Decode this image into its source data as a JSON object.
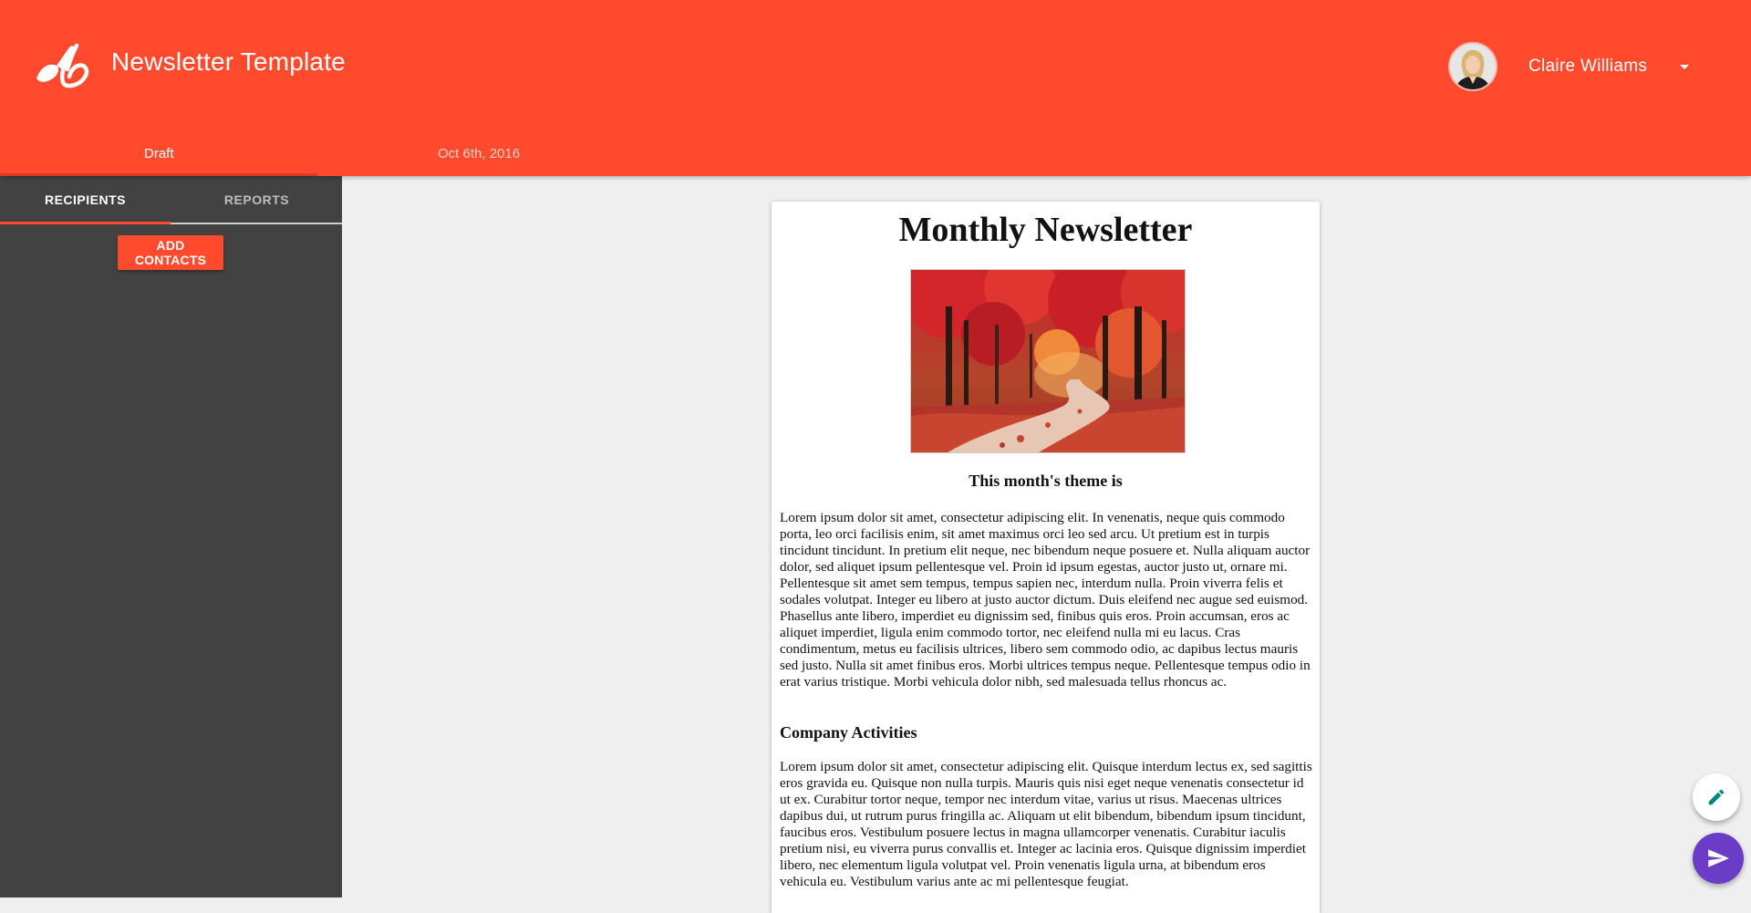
{
  "app": {
    "title": "Newsletter Template",
    "brand_color": "#ff4a2d"
  },
  "user": {
    "name": "Claire Williams",
    "menu_icon": "caret-down-icon"
  },
  "status_bar": {
    "status_label": "Draft",
    "date": "Oct 6th, 2016"
  },
  "sidebar": {
    "tabs": [
      {
        "label": "RECIPIENTS",
        "active": true
      },
      {
        "label": "REPORTS",
        "active": false
      }
    ],
    "add_contacts_label": "ADD CONTACTS",
    "background": "#424242"
  },
  "newsletter": {
    "title": "Monthly Newsletter",
    "image": "autumn-forest-path",
    "subtitle": "This month's theme is",
    "paragraph_1": "Lorem ipsum dolor sit amet, consectetur adipiscing elit. In venenatis, neque quis commodo porta, leo orci facilisis enim, sit amet maximus orci leo sed arcu. Ut pretium est in turpis tincidunt tincidunt. In pretium elit neque, nec bibendum neque posuere et. Nulla aliquam auctor dolor, sed aliquet ipsum pellentesque vel. Proin id ipsum egestas, auctor justo ut, ornare mi. Pellentesque sit amet sem tempus, tempus sapien nec, interdum nulla. Proin viverra felis et sodales volutpat. Integer eu libero at justo auctor dictum. Duis eleifend nec augue sed euismod. Phasellus ante libero, imperdiet eu dignissim sed, finibus quis eros. Proin accumsan, eros ac aliquet imperdiet, ligula enim commodo tortor, nec eleifend nulla mi eu lacus. Cras condimentum, metus eu facilisis ultrices, libero sem commodo odio, ac dapibus lectus mauris sed justo. Nulla sit amet finibus eros. Morbi ultrices tempus neque. Pellentesque tempus odio in erat varius tristique. Morbi vehicula dolor nibh, sed malesuada tellus rhoncus ac.",
    "heading_2": "Company Activities",
    "paragraph_2": "Lorem ipsum dolor sit amet, consectetur adipiscing elit. Quisque interdum lectus ex, sed sagittis eros gravida eu. Quisque non nulla turpis. Mauris quis nisi eget neque venenatis consectetur id ut ex. Curabitur tortor neque, tempor nec interdum vitae, varius ut risus. Maecenas ultrices dapibus dui, ut rutrum purus fringilla ac. Aliquam ut elit bibendum, bibendum ipsum tincidunt, faucibus eros. Vestibulum posuere lectus in magna ullamcorper venenatis. Curabitur iaculis pretium nisi, eu viverra purus convallis et. Integer ac lacinia eros. Quisque dignissim imperdiet libero, nec elementum ligula volutpat vel. Proin venenatis ligula urna, at bibendum eros vehicula eu. Vestibulum varius ante ac mi pellentesque feugiat."
  },
  "fabs": {
    "edit_icon": "pencil-icon",
    "send_icon": "send-icon",
    "send_color": "#6b3cc6",
    "edit_icon_color": "#00897b"
  }
}
